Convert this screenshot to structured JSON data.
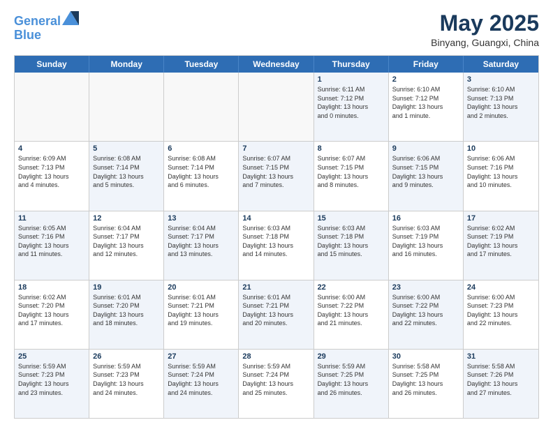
{
  "header": {
    "logo_line1": "General",
    "logo_line2": "Blue",
    "month_title": "May 2025",
    "location": "Binyang, Guangxi, China"
  },
  "day_headers": [
    "Sunday",
    "Monday",
    "Tuesday",
    "Wednesday",
    "Thursday",
    "Friday",
    "Saturday"
  ],
  "weeks": [
    [
      {
        "num": "",
        "info": "",
        "empty": true
      },
      {
        "num": "",
        "info": "",
        "empty": true
      },
      {
        "num": "",
        "info": "",
        "empty": true
      },
      {
        "num": "",
        "info": "",
        "empty": true
      },
      {
        "num": "1",
        "info": "Sunrise: 6:11 AM\nSunset: 7:12 PM\nDaylight: 13 hours\nand 0 minutes.",
        "empty": false
      },
      {
        "num": "2",
        "info": "Sunrise: 6:10 AM\nSunset: 7:12 PM\nDaylight: 13 hours\nand 1 minute.",
        "empty": false
      },
      {
        "num": "3",
        "info": "Sunrise: 6:10 AM\nSunset: 7:13 PM\nDaylight: 13 hours\nand 2 minutes.",
        "empty": false
      }
    ],
    [
      {
        "num": "4",
        "info": "Sunrise: 6:09 AM\nSunset: 7:13 PM\nDaylight: 13 hours\nand 4 minutes.",
        "empty": false
      },
      {
        "num": "5",
        "info": "Sunrise: 6:08 AM\nSunset: 7:14 PM\nDaylight: 13 hours\nand 5 minutes.",
        "empty": false
      },
      {
        "num": "6",
        "info": "Sunrise: 6:08 AM\nSunset: 7:14 PM\nDaylight: 13 hours\nand 6 minutes.",
        "empty": false
      },
      {
        "num": "7",
        "info": "Sunrise: 6:07 AM\nSunset: 7:15 PM\nDaylight: 13 hours\nand 7 minutes.",
        "empty": false
      },
      {
        "num": "8",
        "info": "Sunrise: 6:07 AM\nSunset: 7:15 PM\nDaylight: 13 hours\nand 8 minutes.",
        "empty": false
      },
      {
        "num": "9",
        "info": "Sunrise: 6:06 AM\nSunset: 7:15 PM\nDaylight: 13 hours\nand 9 minutes.",
        "empty": false
      },
      {
        "num": "10",
        "info": "Sunrise: 6:06 AM\nSunset: 7:16 PM\nDaylight: 13 hours\nand 10 minutes.",
        "empty": false
      }
    ],
    [
      {
        "num": "11",
        "info": "Sunrise: 6:05 AM\nSunset: 7:16 PM\nDaylight: 13 hours\nand 11 minutes.",
        "empty": false
      },
      {
        "num": "12",
        "info": "Sunrise: 6:04 AM\nSunset: 7:17 PM\nDaylight: 13 hours\nand 12 minutes.",
        "empty": false
      },
      {
        "num": "13",
        "info": "Sunrise: 6:04 AM\nSunset: 7:17 PM\nDaylight: 13 hours\nand 13 minutes.",
        "empty": false
      },
      {
        "num": "14",
        "info": "Sunrise: 6:03 AM\nSunset: 7:18 PM\nDaylight: 13 hours\nand 14 minutes.",
        "empty": false
      },
      {
        "num": "15",
        "info": "Sunrise: 6:03 AM\nSunset: 7:18 PM\nDaylight: 13 hours\nand 15 minutes.",
        "empty": false
      },
      {
        "num": "16",
        "info": "Sunrise: 6:03 AM\nSunset: 7:19 PM\nDaylight: 13 hours\nand 16 minutes.",
        "empty": false
      },
      {
        "num": "17",
        "info": "Sunrise: 6:02 AM\nSunset: 7:19 PM\nDaylight: 13 hours\nand 17 minutes.",
        "empty": false
      }
    ],
    [
      {
        "num": "18",
        "info": "Sunrise: 6:02 AM\nSunset: 7:20 PM\nDaylight: 13 hours\nand 17 minutes.",
        "empty": false
      },
      {
        "num": "19",
        "info": "Sunrise: 6:01 AM\nSunset: 7:20 PM\nDaylight: 13 hours\nand 18 minutes.",
        "empty": false
      },
      {
        "num": "20",
        "info": "Sunrise: 6:01 AM\nSunset: 7:21 PM\nDaylight: 13 hours\nand 19 minutes.",
        "empty": false
      },
      {
        "num": "21",
        "info": "Sunrise: 6:01 AM\nSunset: 7:21 PM\nDaylight: 13 hours\nand 20 minutes.",
        "empty": false
      },
      {
        "num": "22",
        "info": "Sunrise: 6:00 AM\nSunset: 7:22 PM\nDaylight: 13 hours\nand 21 minutes.",
        "empty": false
      },
      {
        "num": "23",
        "info": "Sunrise: 6:00 AM\nSunset: 7:22 PM\nDaylight: 13 hours\nand 22 minutes.",
        "empty": false
      },
      {
        "num": "24",
        "info": "Sunrise: 6:00 AM\nSunset: 7:23 PM\nDaylight: 13 hours\nand 22 minutes.",
        "empty": false
      }
    ],
    [
      {
        "num": "25",
        "info": "Sunrise: 5:59 AM\nSunset: 7:23 PM\nDaylight: 13 hours\nand 23 minutes.",
        "empty": false
      },
      {
        "num": "26",
        "info": "Sunrise: 5:59 AM\nSunset: 7:23 PM\nDaylight: 13 hours\nand 24 minutes.",
        "empty": false
      },
      {
        "num": "27",
        "info": "Sunrise: 5:59 AM\nSunset: 7:24 PM\nDaylight: 13 hours\nand 24 minutes.",
        "empty": false
      },
      {
        "num": "28",
        "info": "Sunrise: 5:59 AM\nSunset: 7:24 PM\nDaylight: 13 hours\nand 25 minutes.",
        "empty": false
      },
      {
        "num": "29",
        "info": "Sunrise: 5:59 AM\nSunset: 7:25 PM\nDaylight: 13 hours\nand 26 minutes.",
        "empty": false
      },
      {
        "num": "30",
        "info": "Sunrise: 5:58 AM\nSunset: 7:25 PM\nDaylight: 13 hours\nand 26 minutes.",
        "empty": false
      },
      {
        "num": "31",
        "info": "Sunrise: 5:58 AM\nSunset: 7:26 PM\nDaylight: 13 hours\nand 27 minutes.",
        "empty": false
      }
    ]
  ]
}
